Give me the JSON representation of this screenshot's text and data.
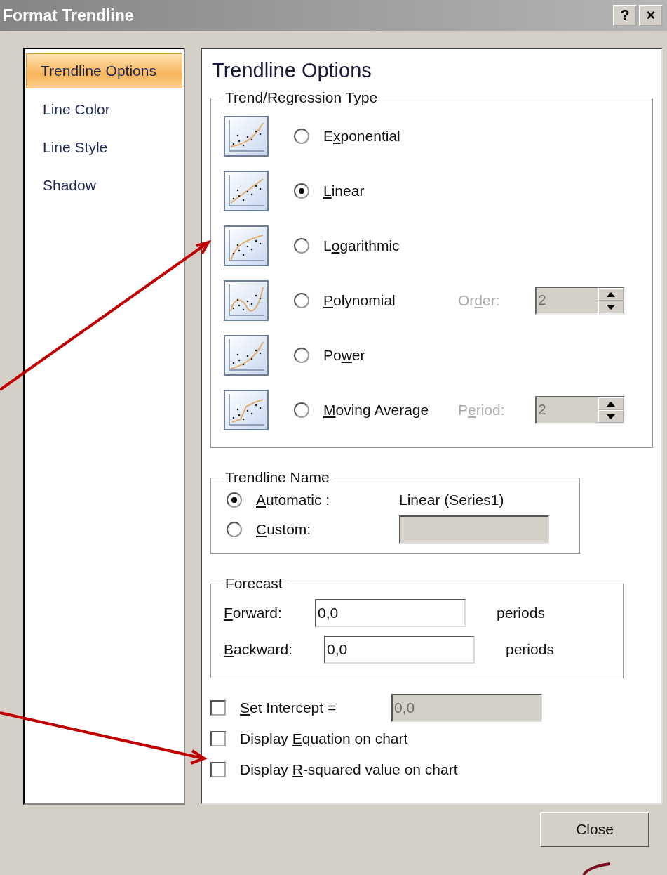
{
  "window": {
    "title": "Format Trendline",
    "buttons": [
      "?",
      "×"
    ]
  },
  "sidebar": {
    "items": [
      {
        "label": "Trendline Options",
        "selected": true
      },
      {
        "label": "Line Color",
        "selected": false
      },
      {
        "label": "Line Style",
        "selected": false
      },
      {
        "label": "Shadow",
        "selected": false
      }
    ]
  },
  "panel": {
    "heading": "Trendline Options",
    "regression": {
      "legend": "Trend/Regression Type",
      "types": [
        {
          "kind": "exponential",
          "label": {
            "before": "E",
            "key": "x",
            "after": "ponential"
          },
          "selected": false
        },
        {
          "kind": "linear",
          "label": {
            "key": "L",
            "after": "inear"
          },
          "selected": true
        },
        {
          "kind": "logarithmic",
          "label": {
            "before": "L",
            "key": "o",
            "after": "garithmic"
          },
          "selected": false
        },
        {
          "kind": "polynomial",
          "label": {
            "key": "P",
            "after": "olynomial"
          },
          "selected": false,
          "spin": {
            "label": {
              "before": "Or",
              "key": "d",
              "after": "er:"
            },
            "value": "2",
            "disabled": true
          }
        },
        {
          "kind": "power",
          "label": {
            "before": "Po",
            "key": "w",
            "after": "er"
          },
          "selected": false
        },
        {
          "kind": "moving_average",
          "label": {
            "key": "M",
            "after": "oving Average"
          },
          "selected": false,
          "spin": {
            "label": {
              "before": "P",
              "key": "e",
              "after": "riod:"
            },
            "value": "2",
            "disabled": true
          }
        }
      ]
    },
    "name": {
      "legend": "Trendline Name",
      "options": [
        {
          "label": {
            "key": "A",
            "after": "utomatic :"
          },
          "selected": true,
          "value": "Linear (Series1)"
        },
        {
          "label": {
            "key": "C",
            "after": "ustom:"
          },
          "selected": false,
          "field_disabled": true
        }
      ]
    },
    "forecast": {
      "legend": "Forecast",
      "rows": [
        {
          "label": {
            "key": "F",
            "after": "orward:"
          },
          "value": "0,0",
          "unit": "periods"
        },
        {
          "label": {
            "key": "B",
            "after": "ackward:"
          },
          "value": "0,0",
          "unit": "periods"
        }
      ]
    },
    "checks": [
      {
        "label": {
          "key": "S",
          "after": "et Intercept ="
        },
        "checked": false,
        "field": {
          "value": "0,0",
          "disabled": true
        }
      },
      {
        "label": {
          "before": "Display ",
          "key": "E",
          "after": "quation on chart"
        },
        "checked": false
      },
      {
        "label": {
          "before": "Display ",
          "key": "R",
          "after": "-squared value on chart"
        },
        "checked": false
      }
    ]
  },
  "close_button": "Close"
}
